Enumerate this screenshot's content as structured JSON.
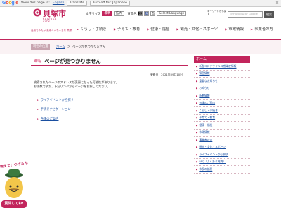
{
  "gtranslate": {
    "view_text": "View this page in:",
    "language": "English",
    "translate_label": "Translate",
    "turn_off_label": "Turn off for: Japanese",
    "close_symbol": "×"
  },
  "header": {
    "logo_title": "貝塚市",
    "logo_en": "KAIZUKA CITY",
    "logo_catch": "自然でゆたか 未来へつなぐまち 貝塚",
    "util": {
      "language_link": "文字サイズ",
      "font_size_label": "文字サイズ",
      "font_standard": "標準",
      "font_large": "拡大",
      "bg_label": "背景色",
      "bg_black": "黒",
      "bg_blue": "青",
      "bg_white": "白",
      "select_language": "Select Language"
    },
    "subline": "キーワードから探す",
    "search_placeholder": "ENHANCED BY Google",
    "search_button": "検索",
    "nav": [
      "くらし・手続き",
      "子育て・教育",
      "健康・福祉",
      "観光・文化・スポーツ",
      "市政情報",
      "事業者の方"
    ]
  },
  "breadcrumb": {
    "tag": "現在の位置",
    "home": "ホーム",
    "separator": "＞",
    "current": "ページが見つかりません"
  },
  "main": {
    "title": "ページが見つかりません",
    "updated": "更新日：2021年09月10日",
    "body_line1": "検索されたページのアドレスが変更になった可能性があります。",
    "body_line2": "お手数ですが、下記リンクからページをお探しください。",
    "links": [
      "ライフイベントから探す",
      "手続きナビゲーション",
      "各課のご案内"
    ]
  },
  "mascot": {
    "top_text": "教えて！つげるん",
    "bubble_text": "質問してね!"
  },
  "sidebar": {
    "head": "ホーム",
    "items": [
      "新型コロナウイルス感染症情報",
      "緊急情報",
      "重要なお知らせ",
      "お知らせ",
      "新着情報",
      "各課のご案内",
      "くらし・手続き",
      "子育て・教育",
      "健康・福祉",
      "市政情報",
      "事業者の方",
      "観光・文化・スポーツ",
      "ライフイベントから探す",
      "FAQ（よくある質問）",
      "市長の部屋"
    ]
  },
  "colors": {
    "accent": "#c2255c",
    "link": "#1a4fa0",
    "band": "#faf2f4"
  }
}
